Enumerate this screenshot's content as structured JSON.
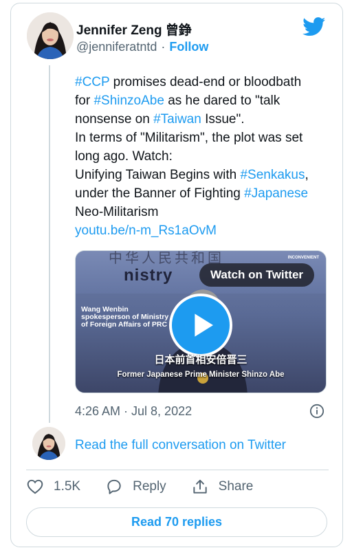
{
  "author": {
    "name": "Jennifer Zeng 曾錚",
    "handle": "@jenniferatntd",
    "separator": "·",
    "follow_label": "Follow"
  },
  "tweet": {
    "lines": [
      [
        {
          "t": "#CCP",
          "tag": true
        },
        {
          "t": " promises dead-end or bloodbath",
          "tag": false
        }
      ],
      [
        {
          "t": "for ",
          "tag": false
        },
        {
          "t": "#ShinzoAbe",
          "tag": true
        },
        {
          "t": " as he dared to \"talk",
          "tag": false
        }
      ],
      [
        {
          "t": "nonsense on ",
          "tag": false
        },
        {
          "t": "#Taiwan",
          "tag": true
        },
        {
          "t": " Issue\".",
          "tag": false
        }
      ],
      [
        {
          "t": "In terms of \"Militarism\", the plot was set",
          "tag": false
        }
      ],
      [
        {
          "t": "long ago. Watch:",
          "tag": false
        }
      ],
      [
        {
          "t": "Unifying Taiwan Begins with ",
          "tag": false
        },
        {
          "t": "#Senkakus",
          "tag": true
        },
        {
          "t": ",",
          "tag": false
        }
      ],
      [
        {
          "t": "under the Banner of Fighting ",
          "tag": false
        },
        {
          "t": "#Japanese",
          "tag": true
        }
      ],
      [
        {
          "t": "Neo-Militarism",
          "tag": false
        }
      ],
      [
        {
          "t": "youtu.be/n-m_Rs1aOvM",
          "tag": true
        }
      ]
    ]
  },
  "media": {
    "watch_label": "Watch on Twitter",
    "background_text": "中华人民共和国",
    "ministry_text": "nistry",
    "speaker_caption": "Wang Wenbin spokesperson of Ministry of Foreign Affairs of PRC",
    "corner_logo": "INCONVENIENT",
    "subtitle_cn": "日本前首相安倍晋三",
    "subtitle_en": "Former Japanese Prime Minister Shinzo Abe"
  },
  "timestamp": "4:26 AM · Jul 8, 2022",
  "read_conversation": "Read the full conversation on Twitter",
  "actions": {
    "likes": "1.5K",
    "reply_label": "Reply",
    "share_label": "Share"
  },
  "read_replies": "Read 70 replies",
  "colors": {
    "accent": "#1d9bf0",
    "text": "#0f1419",
    "secondary": "#536471",
    "border": "#cfd9de"
  }
}
